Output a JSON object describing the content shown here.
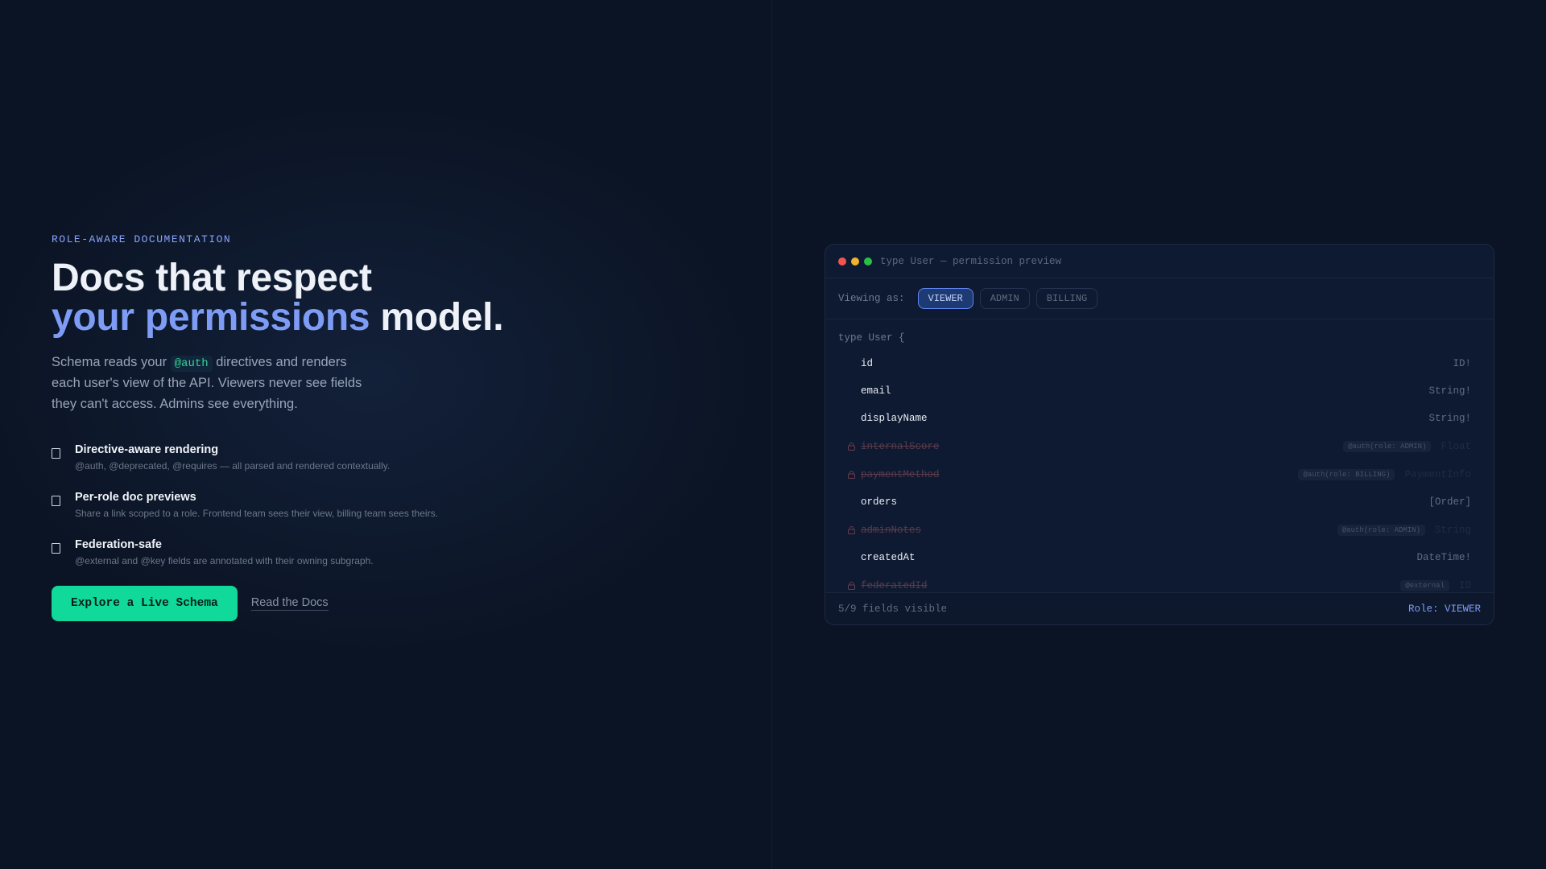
{
  "hero": {
    "eyebrow": "ROLE-AWARE DOCUMENTATION",
    "headline_line1": "Docs that respect",
    "headline_accent": "your permissions",
    "headline_tail": " model.",
    "subtext_before": "Schema reads your ",
    "subtext_code": "@auth",
    "subtext_after": " directives and renders each user's view of the API. Viewers never see fields they can't access. Admins see everything."
  },
  "features": [
    {
      "title": "Directive-aware rendering",
      "desc": "@auth, @deprecated, @requires — all parsed and rendered contextually."
    },
    {
      "title": "Per-role doc previews",
      "desc": "Share a link scoped to a role. Frontend team sees their view, billing team sees theirs."
    },
    {
      "title": "Federation-safe",
      "desc": "@external and @key fields are annotated with their owning subgraph."
    }
  ],
  "cta": {
    "primary_label": "Explore a Live Schema",
    "secondary_label": "Read the Docs",
    "primary_color": "#10d99a"
  },
  "panel": {
    "title": "type User — permission preview",
    "viewing_label": "Viewing as:",
    "roles": [
      "VIEWER",
      "ADMIN",
      "BILLING"
    ],
    "active_role": "VIEWER",
    "type_open": "type User {",
    "fields": [
      {
        "name": "id",
        "type": "ID!",
        "locked": false
      },
      {
        "name": "email",
        "type": "String!",
        "locked": false
      },
      {
        "name": "displayName",
        "type": "String!",
        "locked": false
      },
      {
        "name": "internalScore",
        "type": "Float",
        "locked": true,
        "directive": "@auth(role: ADMIN)"
      },
      {
        "name": "paymentMethod",
        "type": "PaymentInfo",
        "locked": true,
        "directive": "@auth(role: BILLING)"
      },
      {
        "name": "orders",
        "type": "[Order]",
        "locked": false
      },
      {
        "name": "adminNotes",
        "type": "String",
        "locked": true,
        "directive": "@auth(role: ADMIN)"
      },
      {
        "name": "createdAt",
        "type": "DateTime!",
        "locked": false
      },
      {
        "name": "federatedId",
        "type": "ID",
        "locked": true,
        "directive": "@external"
      }
    ],
    "footer_left": "5/9 fields visible",
    "footer_right": "Role: VIEWER",
    "accent_color": "#7e9cf6",
    "lock_color": "#6b3a4d"
  }
}
